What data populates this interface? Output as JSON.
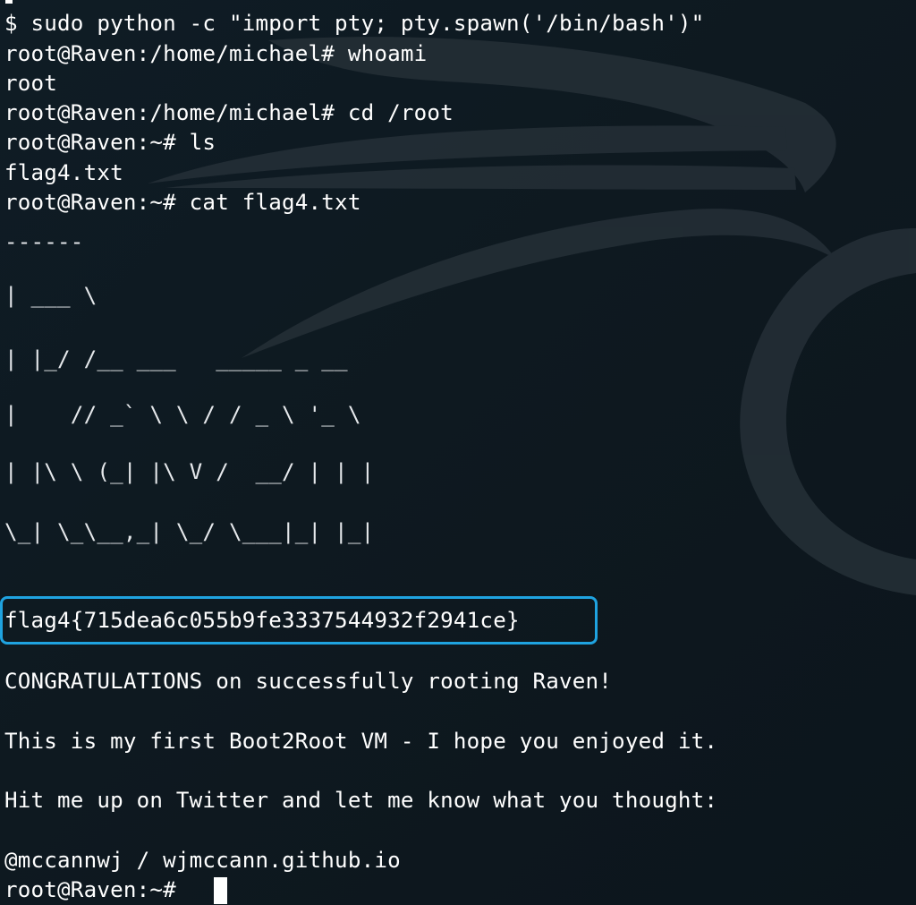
{
  "terminal": {
    "lines": [
      "$ sudo python -c \"import pty; pty.spawn('/bin/bash')\"",
      "root@Raven:/home/michael# whoami",
      "root",
      "root@Raven:/home/michael# cd /root",
      "root@Raven:~# ls",
      "flag4.txt",
      "root@Raven:~# cat flag4.txt",
      "------",
      "| ___ \\",
      "| |_/ /__ ___   _____ _ __",
      "|    // _` \\ \\ / / _ \\ '_ \\",
      "| |\\ \\ (_| |\\ V /  __/ | | |",
      "\\_| \\_\\__,_| \\_/ \\___|_| |_|",
      "flag4{715dea6c055b9fe3337544932f2941ce}",
      "CONGRATULATIONS on successfully rooting Raven!",
      "This is my first Boot2Root VM - I hope you enjoyed it.",
      "Hit me up on Twitter and let me know what you thought:",
      "@mccannwj / wjmccann.github.io",
      "root@Raven:~# "
    ]
  },
  "colors": {
    "background": "#0f1a22",
    "foreground": "#ffffff",
    "highlight_border": "#1fa3e0",
    "wallpaper_logo": "#252f37"
  },
  "icons": {
    "wallpaper": "kali-dragon-logo"
  }
}
